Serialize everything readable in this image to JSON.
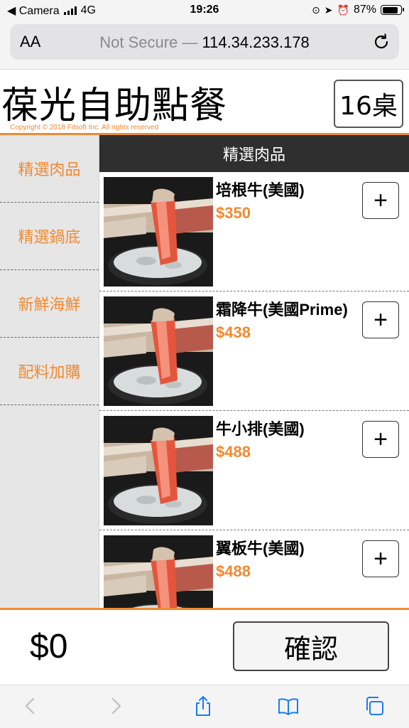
{
  "status_bar": {
    "back_app": "◀ Camera",
    "network": "4G",
    "time": "19:26",
    "battery": "87%",
    "battery_level": 0.87
  },
  "browser": {
    "text_size_label": "AA",
    "security_label": "Not Secure —",
    "host": "114.34.233.178"
  },
  "app": {
    "title": "葆光自助點餐",
    "copyright": "Copyright © 2018 Fitsoft Inc. All rights reserved",
    "table_label": "16桌"
  },
  "sidebar": {
    "categories": [
      {
        "label": "精選肉品"
      },
      {
        "label": "精選鍋底"
      },
      {
        "label": "新鮮海鮮"
      },
      {
        "label": "配料加購"
      }
    ]
  },
  "menu": {
    "header": "精選肉品",
    "add_label": "+",
    "items": [
      {
        "name": "培根牛(美國)",
        "price": "$350"
      },
      {
        "name": "霜降牛(美國Prime)",
        "price": "$438"
      },
      {
        "name": "牛小排(美國)",
        "price": "$488"
      },
      {
        "name": "翼板牛(美國)",
        "price": "$488"
      }
    ]
  },
  "footer": {
    "total": "$0",
    "confirm_label": "確認"
  },
  "colors": {
    "accent": "#f08a32",
    "header_bg": "#2f2f2f",
    "ios_blue": "#1a7cf5"
  }
}
